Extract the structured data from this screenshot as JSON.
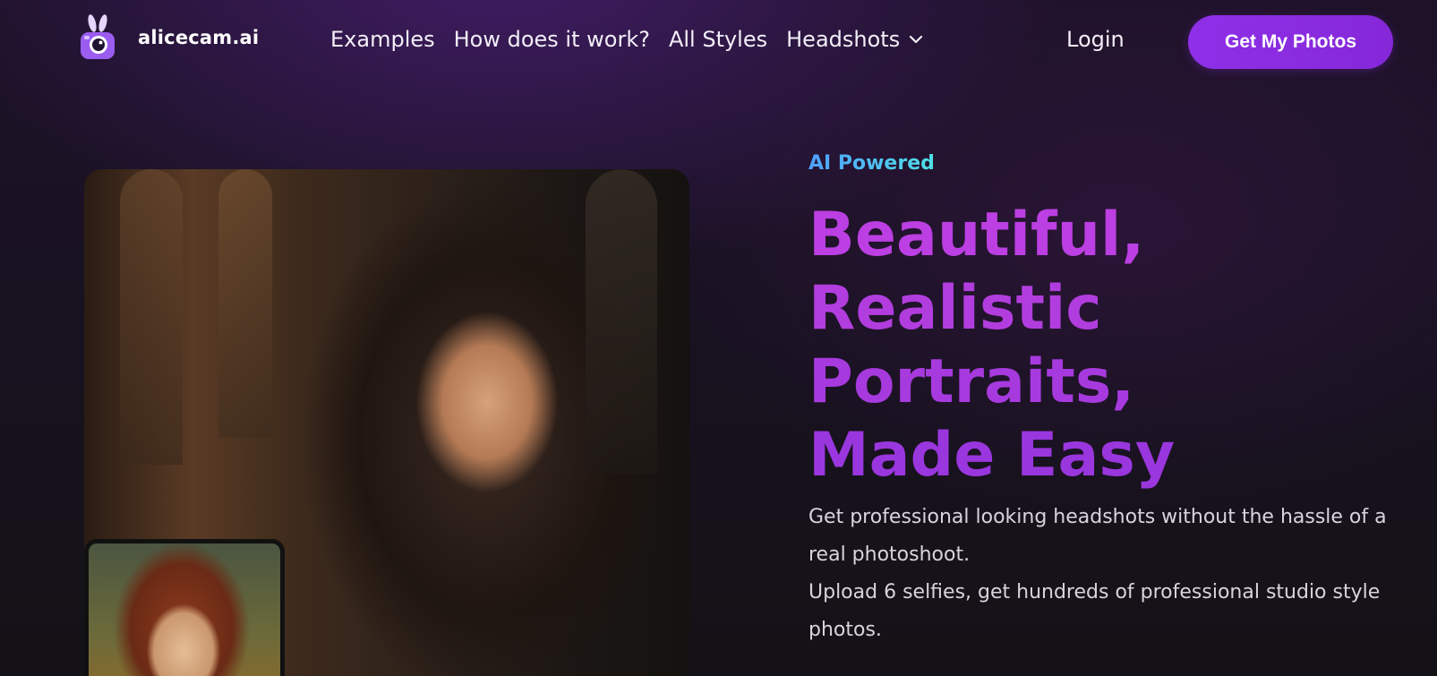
{
  "brand": {
    "name": "alicecam.ai",
    "accent_color": "#8a2be2"
  },
  "nav": {
    "links": [
      {
        "label": "Examples"
      },
      {
        "label": "How does it work?"
      },
      {
        "label": "All Styles"
      },
      {
        "label": "Headshots",
        "icon": "chevron-down-icon"
      }
    ],
    "login_label": "Login",
    "cta_label": "Get My Photos"
  },
  "hero": {
    "eyebrow": "AI Powered",
    "headline_lines": [
      "Beautiful,",
      "Realistic",
      "Portraits,",
      "Made Easy"
    ],
    "description": [
      "Get professional looking headshots without the hassle of a real photoshoot.",
      "Upload 6 selfies, get hundreds of professional studio style photos."
    ],
    "headline_color": "#b43be0",
    "eyebrow_color": "#4fb8f0"
  }
}
